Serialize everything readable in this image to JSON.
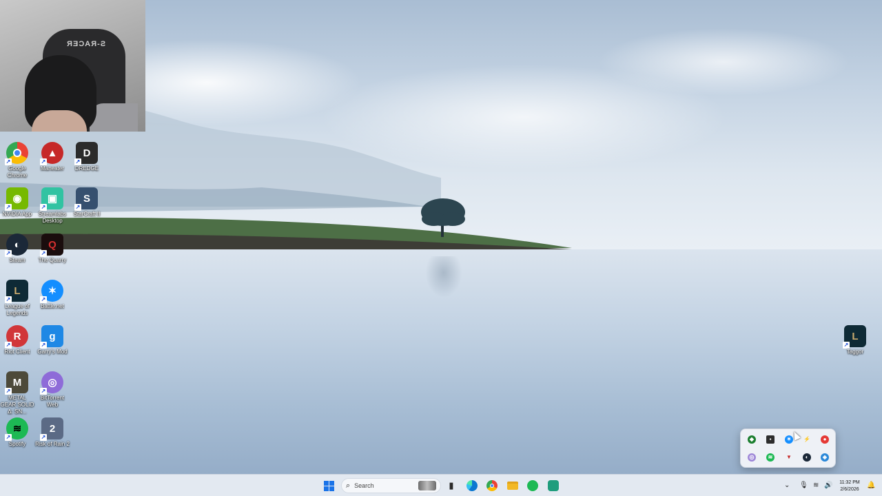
{
  "desktop": {
    "icons": [
      {
        "label": "Google Chrome",
        "glyph": "●",
        "color": "#ea4335",
        "icon": "chrome-icon"
      },
      {
        "label": "Maneater",
        "glyph": "▲",
        "color": "#c62828",
        "icon": "maneater-icon"
      },
      {
        "label": "DREDGE",
        "glyph": "D",
        "color": "#2b2b2b",
        "icon": "dredge-icon"
      },
      {
        "label": "NVIDIA App",
        "glyph": "◉",
        "color": "#76b900",
        "icon": "nvidia-icon"
      },
      {
        "label": "Streamlabs Desktop",
        "glyph": "▣",
        "color": "#31c3a2",
        "icon": "streamlabs-icon"
      },
      {
        "label": "StarCraft II",
        "glyph": "S",
        "color": "#36506f",
        "icon": "starcraft-icon"
      },
      {
        "label": "Steam",
        "glyph": "◐",
        "color": "#1b2838",
        "icon": "steam-icon"
      },
      {
        "label": "The Quarry",
        "glyph": "Q",
        "color": "#6e0f0f",
        "icon": "the-quarry-icon"
      },
      {
        "label": "League of Legends",
        "glyph": "L",
        "color": "#b38b3c",
        "icon": "league-icon"
      },
      {
        "label": "Battle.net",
        "glyph": "✶",
        "color": "#148eff",
        "icon": "battlenet-icon"
      },
      {
        "label": "Riot Client",
        "glyph": "R",
        "color": "#d13639",
        "icon": "riot-client-icon"
      },
      {
        "label": "Garry's Mod",
        "glyph": "g",
        "color": "#1e88e5",
        "icon": "garrys-mod-icon"
      },
      {
        "label": "METAL GEAR SOLID Δ: SN...",
        "glyph": "M",
        "color": "#4d4a3a",
        "icon": "metal-gear-icon"
      },
      {
        "label": "BitTorrent Web",
        "glyph": "◎",
        "color": "#8e6bd8",
        "icon": "bittorrent-icon"
      },
      {
        "label": "Spotify",
        "glyph": "≋",
        "color": "#1db954",
        "icon": "spotify-icon"
      },
      {
        "label": "Risk of Rain 2",
        "glyph": "2",
        "color": "#5b6a85",
        "icon": "risk-of-rain-icon"
      },
      {
        "label": "Taggor",
        "glyph": "L",
        "color": "#b38b3c",
        "icon": "league-icon"
      }
    ]
  },
  "webcam": {
    "chair_text": "S-RACER"
  },
  "tray_flyout": {
    "icons": [
      {
        "name": "razer-tray-icon",
        "color": "#1b7e2f",
        "glyph": "◆"
      },
      {
        "name": "nvidia-tray-icon",
        "color": "#2d2d2d",
        "glyph": "▪"
      },
      {
        "name": "battlenet-tray-icon",
        "color": "#148eff",
        "glyph": "✶"
      },
      {
        "name": "bolt-tray-icon",
        "color": "#e53935",
        "glyph": "⚡"
      },
      {
        "name": "record-tray-icon",
        "color": "#e53935",
        "glyph": "●"
      },
      {
        "name": "bittorrent-tray-icon",
        "color": "#9f88d8",
        "glyph": "◎"
      },
      {
        "name": "spotify-tray-icon",
        "color": "#1db954",
        "glyph": "≋"
      },
      {
        "name": "riot-tray-icon",
        "color": "#c62828",
        "glyph": "▼"
      },
      {
        "name": "steam-tray-icon",
        "color": "#1b2838",
        "glyph": "◐"
      },
      {
        "name": "defender-tray-icon",
        "color": "#2b88d8",
        "glyph": "◈"
      }
    ]
  },
  "taskbar": {
    "search_placeholder": "Search",
    "apps": [
      {
        "name": "task-view-icon",
        "glyph": "▮",
        "color": "#2a2a2a"
      },
      {
        "name": "edge-icon",
        "glyph": "◍",
        "color": "#0c78d1"
      },
      {
        "name": "chrome-taskbar-icon",
        "glyph": "●",
        "color": "#ea4335"
      },
      {
        "name": "file-explorer-icon",
        "glyph": "▬",
        "color": "#f2b824"
      },
      {
        "name": "spotify-taskbar-icon",
        "glyph": "≋",
        "color": "#1db954"
      },
      {
        "name": "streamlabs-taskbar-icon",
        "glyph": "▣",
        "color": "#1f9d7d"
      }
    ],
    "time": "11:32 PM",
    "date": "2/6/2026"
  },
  "colors": {
    "start_blue": "#1a73e8",
    "taskbar_bg": "#e3e9f1"
  }
}
